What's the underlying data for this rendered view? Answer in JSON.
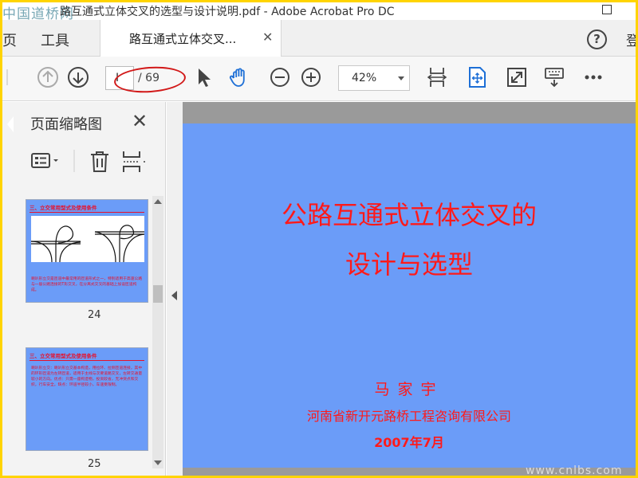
{
  "titlebar": {
    "watermark": "中国道桥网",
    "title": "路互通式立体交叉的选型与设计说明.pdf - Adobe Acrobat Pro DC"
  },
  "tabs": {
    "home_fragment": "页",
    "tools": "工具",
    "document": "路互通式立体交叉...",
    "help": "?",
    "signin_fragment": "登"
  },
  "toolbar": {
    "current_page": "I",
    "total_pages": "/ 69",
    "zoom": "42%"
  },
  "thumbnails_panel": {
    "title": "页面缩略图",
    "pages": [
      {
        "number": "24",
        "heading": "三、立交常用型式及使用条件",
        "text": "喇叭形立交是匝道中最常用的匝道形式之一，特别适用于高速公路与一般公路连接的T形交叉，在分离式交叉的基础上加设匝道构成。"
      },
      {
        "number": "25",
        "heading": "三、立交常用型式及使用条件",
        "text": "喇叭形立交：喇叭形立交基本构造，用拉环、拉侧匝道连接，其中的环形匝道为左转匝道，适用于主线与次要道路交叉，左转交通量较小的方向。优点：只需一座构造物，投资较省，无冲突点和交织，行车安全。缺点：环道半径较小，车速受限制。"
      }
    ]
  },
  "slide": {
    "title_line1": "公路互通式立体交叉的",
    "title_line2": "设计与选型",
    "author": "马家宇",
    "organization": "河南省新开元路桥工程咨询有限公司",
    "date": "2007年7月"
  },
  "bottom_watermark": "www.cnlbs.com",
  "colors": {
    "slide_bg": "#6b9cf8",
    "slide_text": "#ff1a1a",
    "frame": "#ffd400",
    "annotation": "#d21919"
  }
}
